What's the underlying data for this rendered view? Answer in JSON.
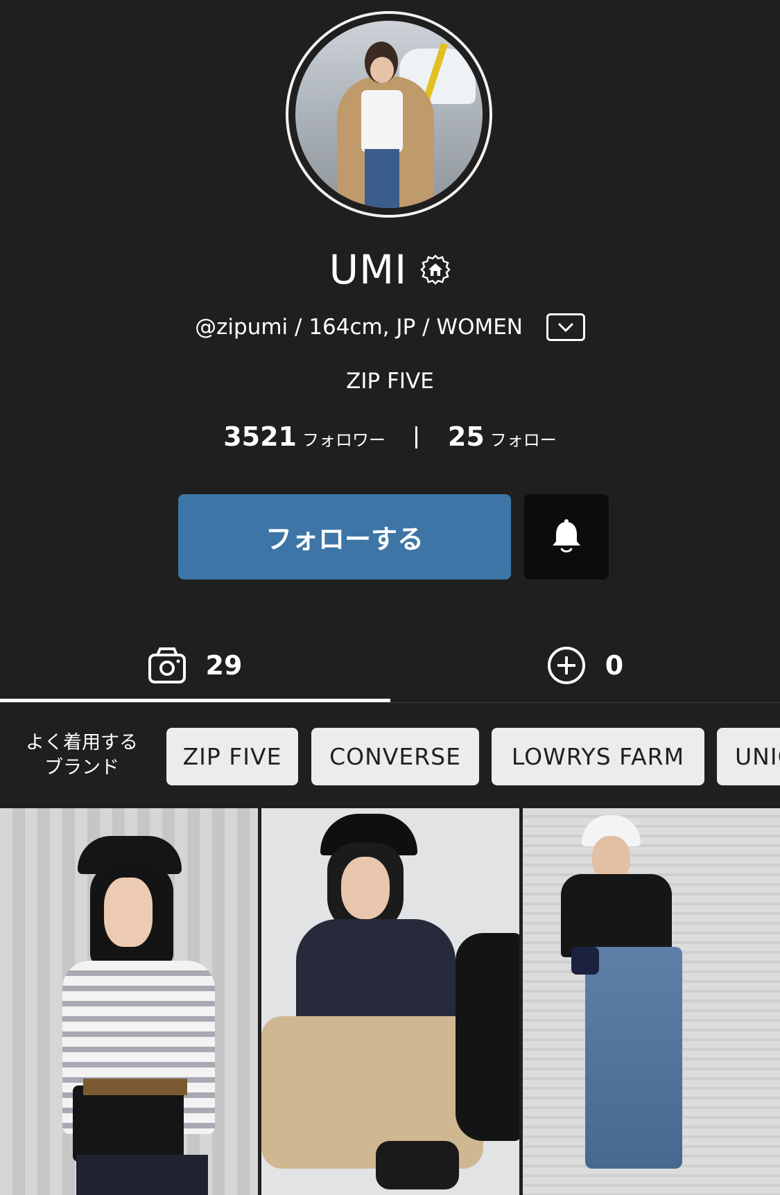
{
  "profile": {
    "name": "UMI",
    "meta": "@zipumi / 164cm, JP / WOMEN",
    "shop": "ZIP FIVE",
    "followers_count": "3521",
    "followers_label": "フォロワー",
    "following_count": "25",
    "following_label": "フォロー"
  },
  "actions": {
    "follow_label": "フォローする"
  },
  "tabs": {
    "posts_count": "29",
    "saved_count": "0"
  },
  "brands": {
    "label_line1": "よく着用する",
    "label_line2": "ブランド",
    "items": [
      "ZIP FIVE",
      "CONVERSE",
      "LOWRYS FARM",
      "UNIQLO"
    ]
  },
  "icons": [
    "shop-badge-icon",
    "chevron-down-icon",
    "bell-icon",
    "camera-icon",
    "plus-circle-icon"
  ],
  "colors": {
    "background": "#1f1f1f",
    "follow_button": "#3d76a6",
    "bell_button": "#0c0c0c",
    "chip": "#ececec"
  }
}
